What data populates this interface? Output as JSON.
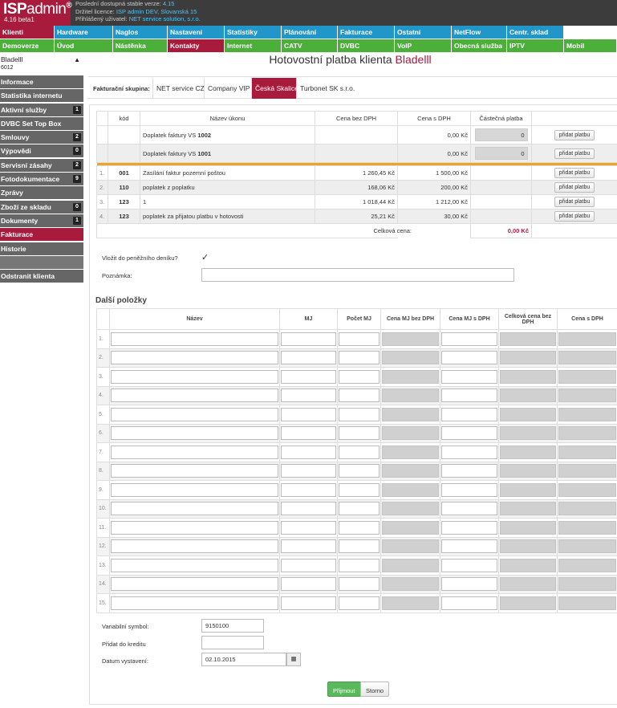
{
  "header": {
    "brand_bold": "ISP",
    "brand_rest": "admin",
    "brand_mark": "®",
    "version": "4.16 beta1",
    "info": [
      {
        "label": "Poslední dostupná stable verze:",
        "value": "4.15"
      },
      {
        "label": "Držitel licence:",
        "value": "ISP admin DEV, Slovanská 15"
      },
      {
        "label": "Přihlášený uživatel:",
        "value": "NET service solution, s.r.o."
      }
    ]
  },
  "menu_row1": [
    "Klienti",
    "Hardware",
    "Naglos",
    "Nastavení",
    "Statistiky",
    "Plánování",
    "Fakturace",
    "Ostatní",
    "NetFlow",
    "Centr. sklad",
    ""
  ],
  "menu_row2": [
    "Demoverze",
    "Úvod",
    "Nástěnka",
    "Kontakty",
    "Internet",
    "CATV",
    "DVBC",
    "VoIP",
    "Obecná služba",
    "IPTV",
    "Mobil"
  ],
  "client": {
    "name": "Bladelll",
    "id": "6012"
  },
  "sidebar": [
    {
      "label": "Informace",
      "badge": ""
    },
    {
      "label": "Statistika internetu",
      "badge": ""
    },
    {
      "label": "Aktivní služby",
      "badge": "1"
    },
    {
      "label": "DVBC Set Top Box",
      "badge": ""
    },
    {
      "label": "Smlouvy",
      "badge": "2"
    },
    {
      "label": "Výpovědi",
      "badge": "0"
    },
    {
      "label": "Servisní zásahy",
      "badge": "2"
    },
    {
      "label": "Fotodokumentace",
      "badge": "9"
    },
    {
      "label": "Zprávy",
      "badge": ""
    },
    {
      "label": "Zboží ze skladu",
      "badge": "0"
    },
    {
      "label": "Dokumenty",
      "badge": "1"
    },
    {
      "label": "Fakturace",
      "badge": ""
    },
    {
      "label": "Historie",
      "badge": ""
    },
    {
      "label": "",
      "badge": ""
    },
    {
      "label": "Odstranit klienta",
      "badge": ""
    }
  ],
  "page_title": {
    "prefix": "Hotovostní platba klienta",
    "name": "Bladelll"
  },
  "billing_group": {
    "label": "Fakturační skupina:",
    "tabs": [
      "NET service CZ",
      "Company VIP",
      "Česká Skalice",
      "Turbonet SK s.r.o."
    ],
    "active": "Česká Skalice"
  },
  "payment_table": {
    "headers": [
      "kód",
      "Název úkonu",
      "Cena bez DPH",
      "Cena s DPH",
      "Částečná platba"
    ],
    "surcharges": [
      {
        "name_prefix": "Doplatek faktury VS",
        "vs": "1002",
        "price_vat": "0,00 Kč",
        "partial": "0"
      },
      {
        "name_prefix": "Doplatek faktury VS",
        "vs": "1001",
        "price_vat": "0,00 Kč",
        "partial": "0"
      }
    ],
    "items": [
      {
        "num": "1.",
        "code": "001",
        "name": "Zasílání faktur pozemní poštou",
        "price": "1 260,45 Kč",
        "price_vat": "1 500,00 Kč"
      },
      {
        "num": "2.",
        "code": "110",
        "name": "poplatek z poplatku",
        "price": "168,06 Kč",
        "price_vat": "200,00 Kč"
      },
      {
        "num": "3.",
        "code": "123",
        "name": "1",
        "price": "1 018,44 Kč",
        "price_vat": "1 212,00 Kč"
      },
      {
        "num": "4.",
        "code": "123",
        "name": "poplatek za přijatou platbu v hotovosti",
        "price": "25,21 Kč",
        "price_vat": "30,00 Kč"
      }
    ],
    "pay_button": "přidat platbu",
    "total_label": "Celková cena:",
    "total_value": "0,00 Kč"
  },
  "form": {
    "journal_label": "Vložit do peněžního deníku?",
    "journal_checked": "✓",
    "note_label": "Poznámka:",
    "note_value": ""
  },
  "extra": {
    "title": "Další položky",
    "headers": [
      "Název",
      "MJ",
      "Počet MJ",
      "Cena MJ bez DPH",
      "Cena MJ s DPH",
      "Celková cena bez DPH",
      "Cena s DPH"
    ],
    "rows": [
      "1.",
      "2.",
      "3.",
      "4.",
      "5.",
      "6.",
      "7.",
      "8.",
      "9.",
      "10.",
      "11.",
      "12.",
      "13.",
      "14.",
      "15."
    ]
  },
  "bottom": {
    "vs_label": "Variabilní symbol:",
    "vs_value": "9150100",
    "credit_label": "Přidat do kreditu",
    "credit_value": "",
    "date_label": "Datum vystavení:",
    "date_value": "02.10.2015",
    "accept": "Přijmout",
    "cancel": "Storno"
  },
  "colors": {
    "brand": "#a81b3c",
    "blue": "#2196c9",
    "green": "#4caf3a",
    "separator": "#e9a628",
    "accept": "#5cb85c"
  }
}
